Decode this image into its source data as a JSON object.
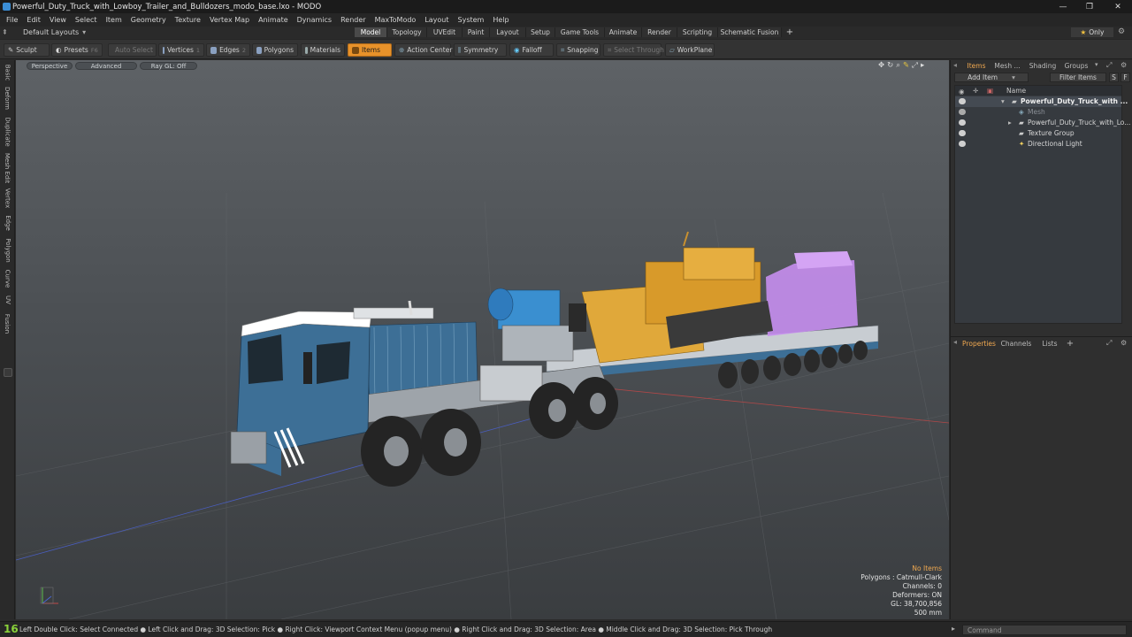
{
  "window": {
    "title": "Powerful_Duty_Truck_with_Lowboy_Trailer_and_Bulldozers_modo_base.lxo - MODO",
    "minimize": "—",
    "maximize": "❐",
    "close": "✕"
  },
  "menu": [
    "File",
    "Edit",
    "View",
    "Select",
    "Item",
    "Geometry",
    "Texture",
    "Vertex Map",
    "Animate",
    "Dynamics",
    "Render",
    "MaxToModo",
    "Layout",
    "System",
    "Help"
  ],
  "layouts": {
    "selector": "Default Layouts",
    "tabs": [
      "Model",
      "Topology",
      "UVEdit",
      "Paint",
      "Layout",
      "Setup",
      "Game Tools",
      "Animate",
      "Render",
      "Scripting",
      "Schematic Fusion"
    ],
    "active_tab": "Model",
    "add": "+",
    "only": "Only"
  },
  "toolbar": {
    "sculpt": "Sculpt",
    "presets": "Presets",
    "presets_key": "F6",
    "auto_select": "Auto Select",
    "vertices": "Vertices",
    "vertices_key": "1",
    "edges": "Edges",
    "edges_key": "2",
    "polygons": "Polygons",
    "polygons_key": "3",
    "materials": "Materials",
    "items": "Items",
    "action_center": "Action Center",
    "symmetry": "Symmetry",
    "falloff": "Falloff",
    "snapping": "Snapping",
    "select_through": "Select Through",
    "workplane": "WorkPlane"
  },
  "left_tabs": [
    "Basic",
    "Deform",
    "Duplicate",
    "Mesh Edit",
    "Vertex",
    "Edge",
    "Polygon",
    "Curve",
    "UV",
    "Fusion"
  ],
  "viewport": {
    "view_mode": "Perspective",
    "shading": "Advanced",
    "raygl": "Ray GL: Off",
    "info": {
      "no_items": "No Items",
      "polygons": "Polygons : Catmull-Clark",
      "channels": "Channels: 0",
      "deformers": "Deformers: ON",
      "gl": "GL: 38,700,856",
      "scale": "500 mm"
    }
  },
  "items_panel": {
    "tabs": [
      "Items",
      "Mesh ...",
      "Shading",
      "Groups"
    ],
    "active_tab": "Items",
    "add_item": "Add Item",
    "filter_items": "Filter Items",
    "s_btn": "S",
    "f_btn": "F",
    "column_name": "Name",
    "rows": [
      {
        "label": "Powerful_Duty_Truck_with ...",
        "bold": true
      },
      {
        "label": "Mesh",
        "dim": true
      },
      {
        "label": "Powerful_Duty_Truck_with_Lo..."
      },
      {
        "label": "Texture Group"
      },
      {
        "label": "Directional Light"
      }
    ]
  },
  "props_panel": {
    "tabs": [
      "Properties",
      "Channels",
      "Lists"
    ],
    "active_tab": "Properties",
    "add": "+"
  },
  "status": {
    "fps": "16",
    "hint": "Left Double Click: Select Connected ● Left Click and Drag: 3D Selection: Pick ● Right Click: Viewport Context Menu (popup menu) ● Right Click and Drag: 3D Selection: Area ● Middle Click and Drag: 3D Selection: Pick Through",
    "command_placeholder": "Command"
  },
  "colors": {
    "accent": "#e8922a",
    "cab_blue": "#3d6f96",
    "bulldozer_yellow": "#e0a83a",
    "ghost_purple": "#c68ef0"
  }
}
